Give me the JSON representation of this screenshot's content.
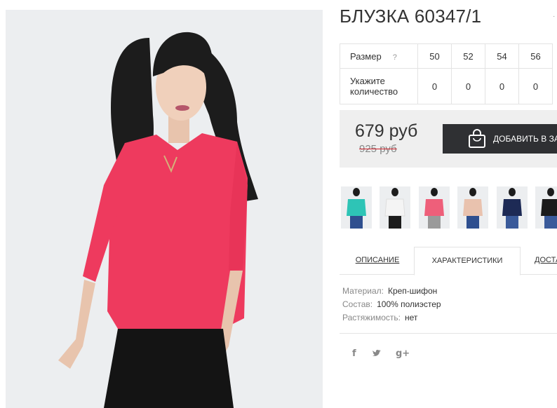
{
  "product": {
    "title": "БЛУЗКА 60347/1",
    "corner_glyph": "·"
  },
  "sizes": {
    "row_label": "Размер",
    "help_label": "?",
    "values": [
      "50",
      "52",
      "54",
      "56"
    ],
    "qty_label_line1": "Укажите",
    "qty_label_line2": "количество",
    "quantities": [
      "0",
      "0",
      "0",
      "0"
    ]
  },
  "price": {
    "current": "679 руб",
    "old": "925 руб",
    "old_strike_color": "#d0202a"
  },
  "cart_button": {
    "label": "ДОБАВИТЬ В ЗАКАЗ",
    "icon": "shopping-bag-icon"
  },
  "thumbnails": [
    {
      "color_name": "turquoise",
      "color": "#2ec4b6"
    },
    {
      "color_name": "white",
      "color": "#f4f4f4"
    },
    {
      "color_name": "pink",
      "color": "#ee5f7a"
    },
    {
      "color_name": "beige",
      "color": "#e9c2ae"
    },
    {
      "color_name": "navy",
      "color": "#1d2a55"
    },
    {
      "color_name": "black",
      "color": "#1b1b1b"
    }
  ],
  "tabs": {
    "description": "ОПИСАНИЕ",
    "characteristics": "ХАРАКТЕРИСТИКИ",
    "delivery": "ДОСТАВКА"
  },
  "specs": [
    {
      "label": "Материал:",
      "value": "Креп-шифон"
    },
    {
      "label": "Состав:",
      "value": "100% полиэстер"
    },
    {
      "label": "Растяжимость:",
      "value": "нет"
    }
  ],
  "social": {
    "facebook": "f",
    "twitter": "🐦",
    "google_plus": "g+"
  },
  "colors": {
    "blouse": "#ee3a5e",
    "button_bg": "#2f3033",
    "price_box_bg": "#efefef"
  }
}
